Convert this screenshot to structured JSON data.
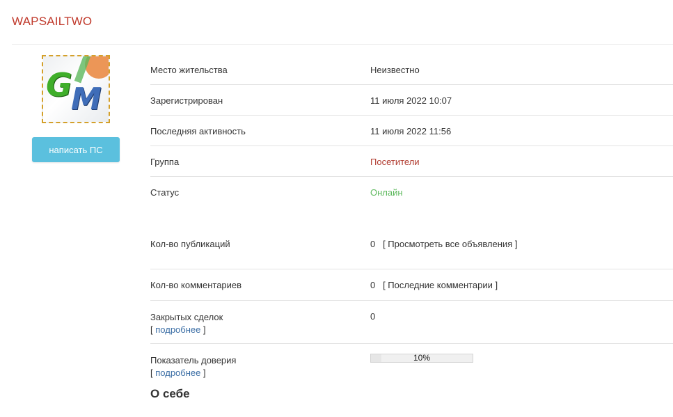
{
  "profile": {
    "username": "WAPSAILTWO",
    "avatar_text_1": "G",
    "avatar_text_2": "M",
    "pm_button_label": "написать ПС"
  },
  "info": {
    "residence_label": "Место жительства",
    "residence_value": "Неизвестно",
    "registered_label": "Зарегистрирован",
    "registered_value": "11 июля 2022 10:07",
    "last_activity_label": "Последняя активность",
    "last_activity_value": "11 июля 2022 11:56",
    "group_label": "Группа",
    "group_value": "Посетители",
    "status_label": "Статус",
    "status_value": "Онлайн",
    "posts_label": "Кол-во публикаций",
    "posts_count": "0",
    "posts_link": "[ Просмотреть все объявления ]",
    "comments_label": "Кол-во комментариев",
    "comments_count": "0",
    "comments_link": "[ Последние комментарии ]",
    "deals_label": "Закрытых сделок",
    "deals_value": "0",
    "deals_more_open": "[",
    "deals_more_link": "подробнее",
    "deals_more_close": "]",
    "trust_label": "Показатель доверия",
    "trust_value": "10%",
    "trust_fraction": 0.1,
    "trust_more_open": "[",
    "trust_more_link": "подробнее",
    "trust_more_close": "]"
  },
  "about": {
    "title": "О себе"
  },
  "colors": {
    "username": "#c0392b",
    "button": "#5bc0de",
    "group": "#b03a2e",
    "status_online": "#5cb85c",
    "link": "#3b6ea5"
  }
}
